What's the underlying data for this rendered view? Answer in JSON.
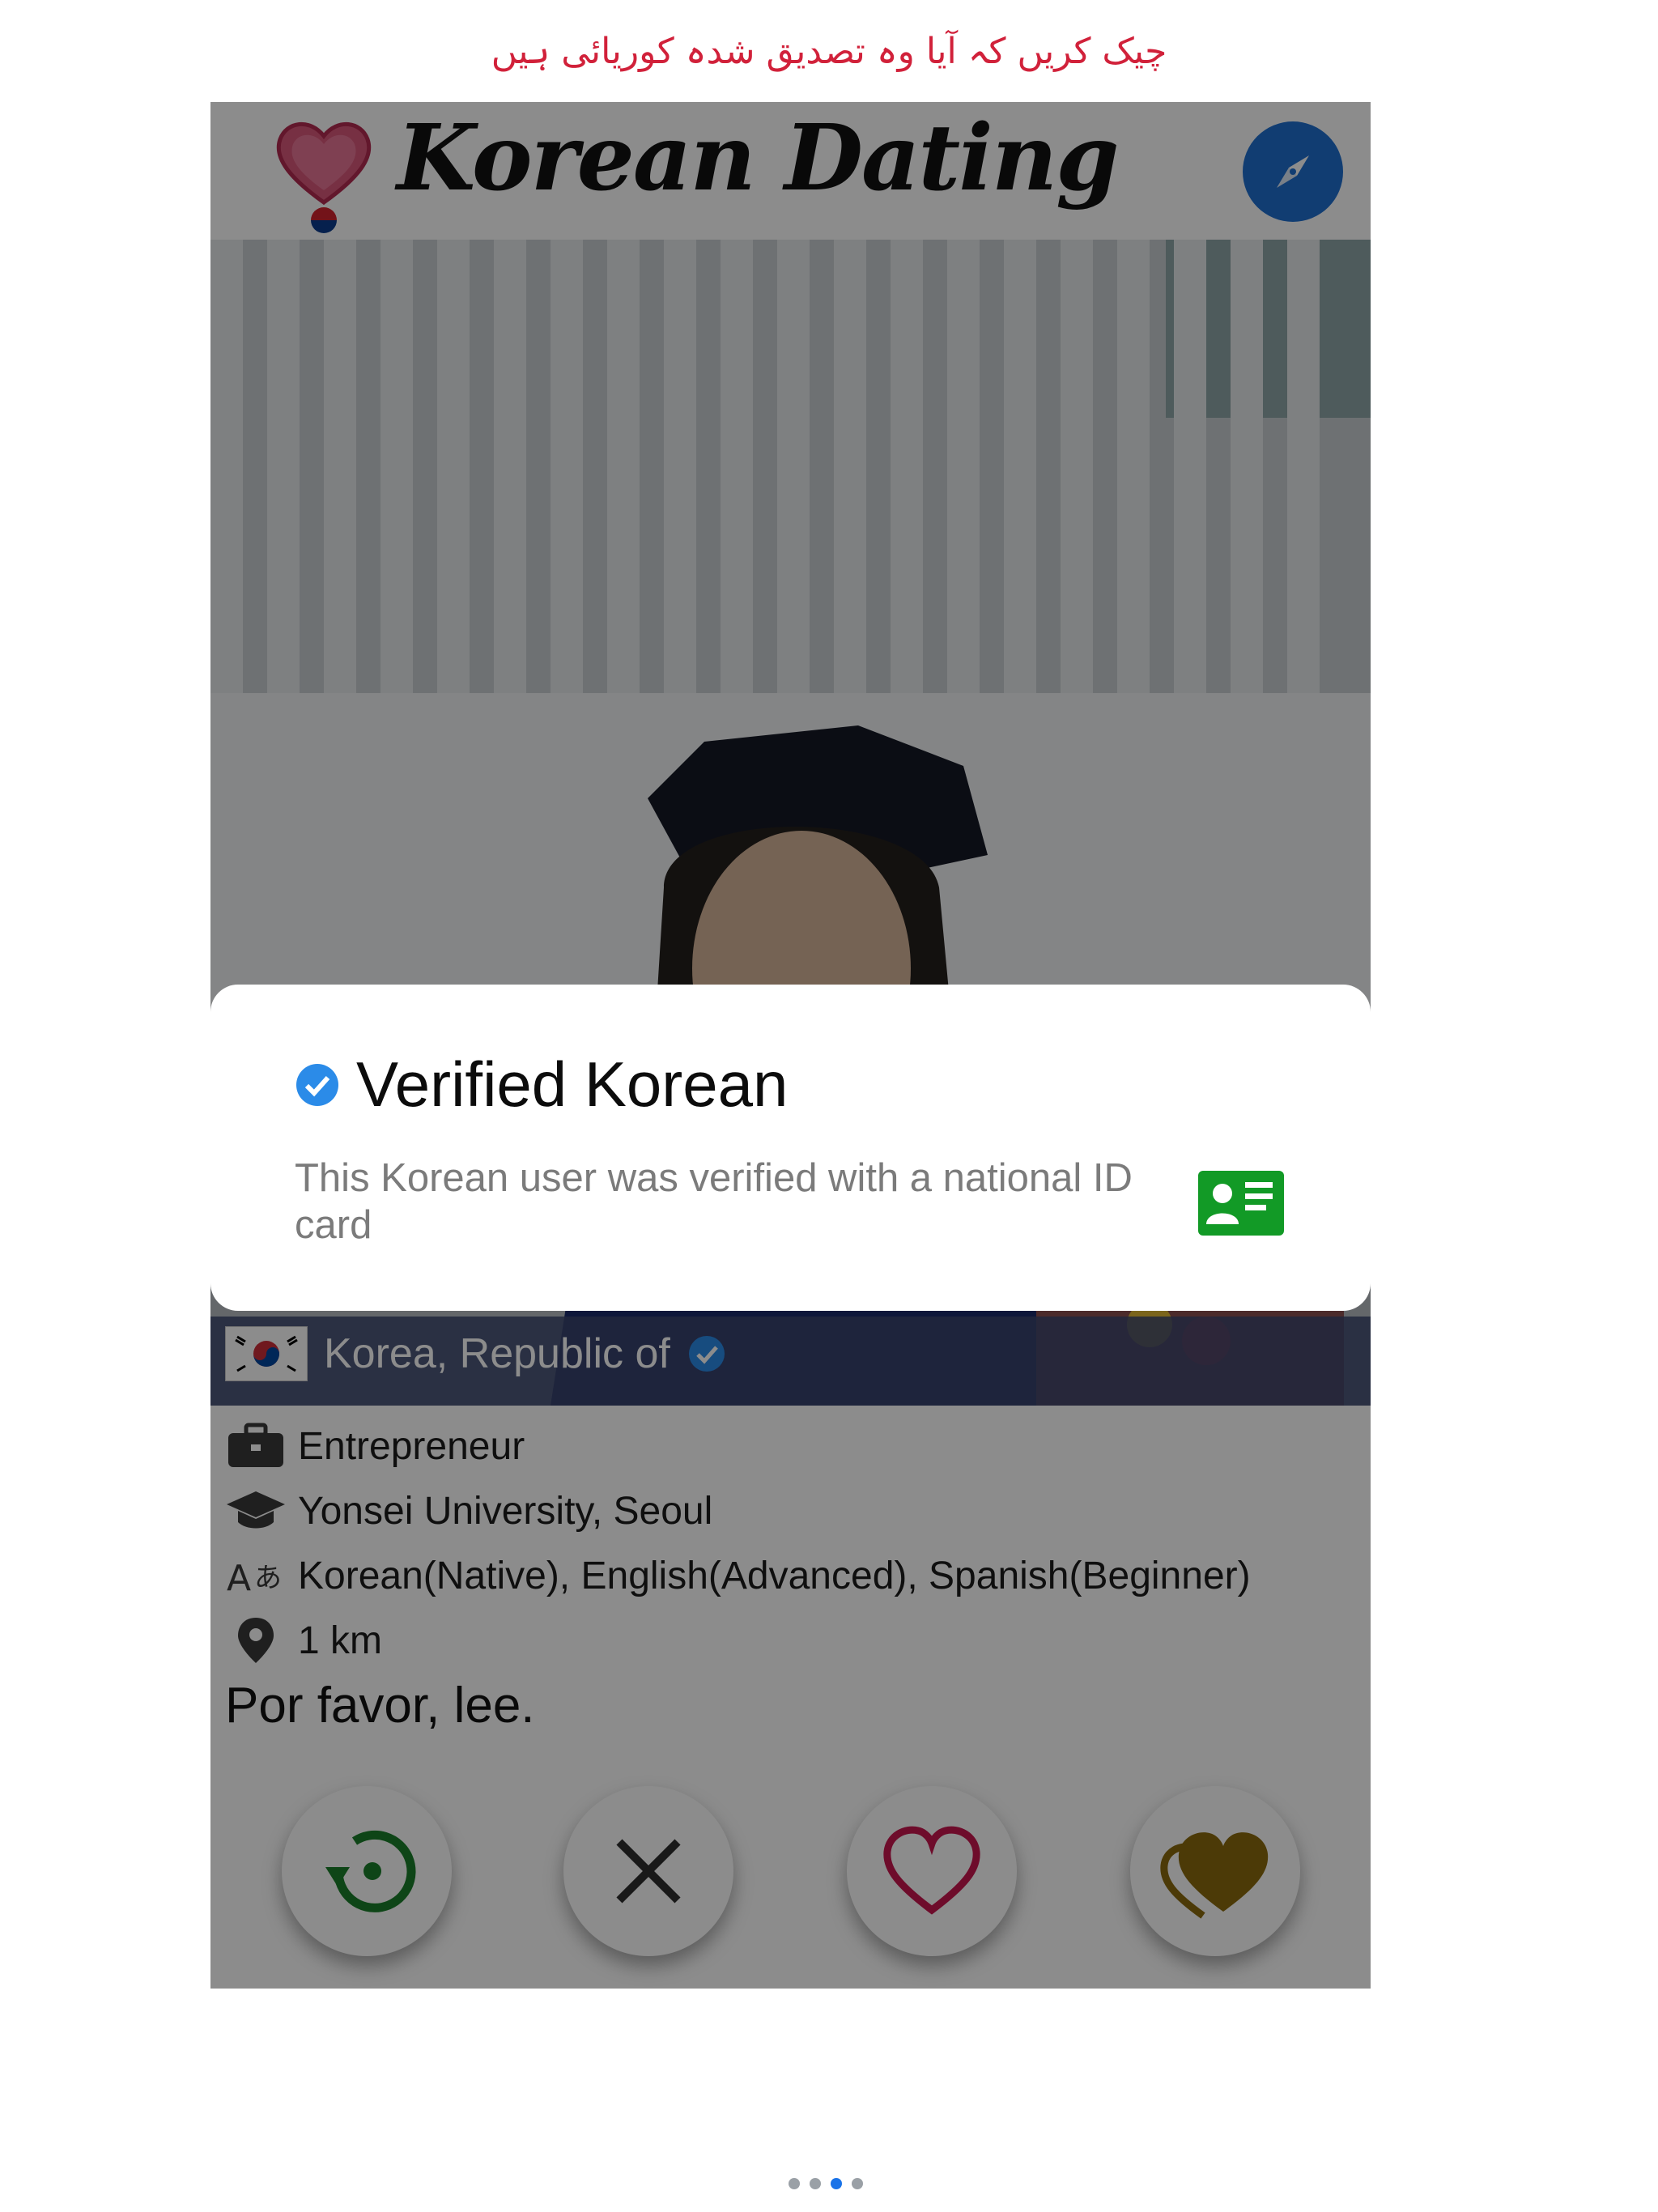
{
  "caption": "چیک کریں کہ آیا وہ تصدیق شدہ کوریائی ہیں",
  "app": {
    "title": "Korean Dating"
  },
  "profile": {
    "country": "Korea, Republic of",
    "job": "Entrepreneur",
    "school": "Yonsei University, Seoul",
    "languages": "Korean(Native), English(Advanced), Spanish(Beginner)",
    "distance": "1 km",
    "bio": "Por favor, lee."
  },
  "modal": {
    "title": "Verified Korean",
    "text": "This Korean user was verified with a national ID card"
  },
  "colors": {
    "caption": "#d1213a",
    "accent_blue": "#1f6fd0",
    "undo_green": "#1b7f2a",
    "like_red": "#c8174f",
    "superlike_gold": "#8a6a0e",
    "id_green": "#129a26"
  },
  "pager": {
    "count": 4,
    "active": 3
  }
}
